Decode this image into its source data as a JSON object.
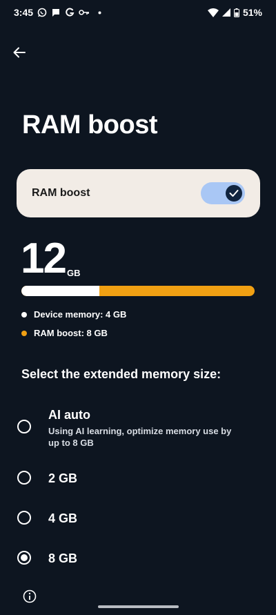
{
  "status_bar": {
    "time": "3:45",
    "notification_icons": [
      "whatsapp-icon",
      "chat-icon",
      "google-icon",
      "key-icon",
      "dot-icon"
    ],
    "battery": "51%"
  },
  "page": {
    "title": "RAM boost"
  },
  "toggle": {
    "label": "RAM boost",
    "enabled": true
  },
  "memory": {
    "total_value": "12",
    "total_unit": "GB",
    "device_fraction": 0.3333,
    "legend": [
      {
        "label": "Device memory: 4 GB",
        "color": "#ffffff"
      },
      {
        "label": "RAM boost: 8 GB",
        "color": "#f0a013"
      }
    ]
  },
  "selection": {
    "title": "Select the extended memory size:",
    "options": [
      {
        "label": "AI auto",
        "desc": "Using AI learning, optimize memory use by up to 8 GB",
        "selected": false
      },
      {
        "label": "2 GB",
        "desc": "",
        "selected": false
      },
      {
        "label": "4 GB",
        "desc": "",
        "selected": false
      },
      {
        "label": "8 GB",
        "desc": "",
        "selected": true
      }
    ]
  },
  "colors": {
    "background": "#0d1520",
    "card": "#f2ece6",
    "switch_track": "#a9c7f5",
    "switch_knob": "#10243f",
    "boost": "#f0a013"
  }
}
